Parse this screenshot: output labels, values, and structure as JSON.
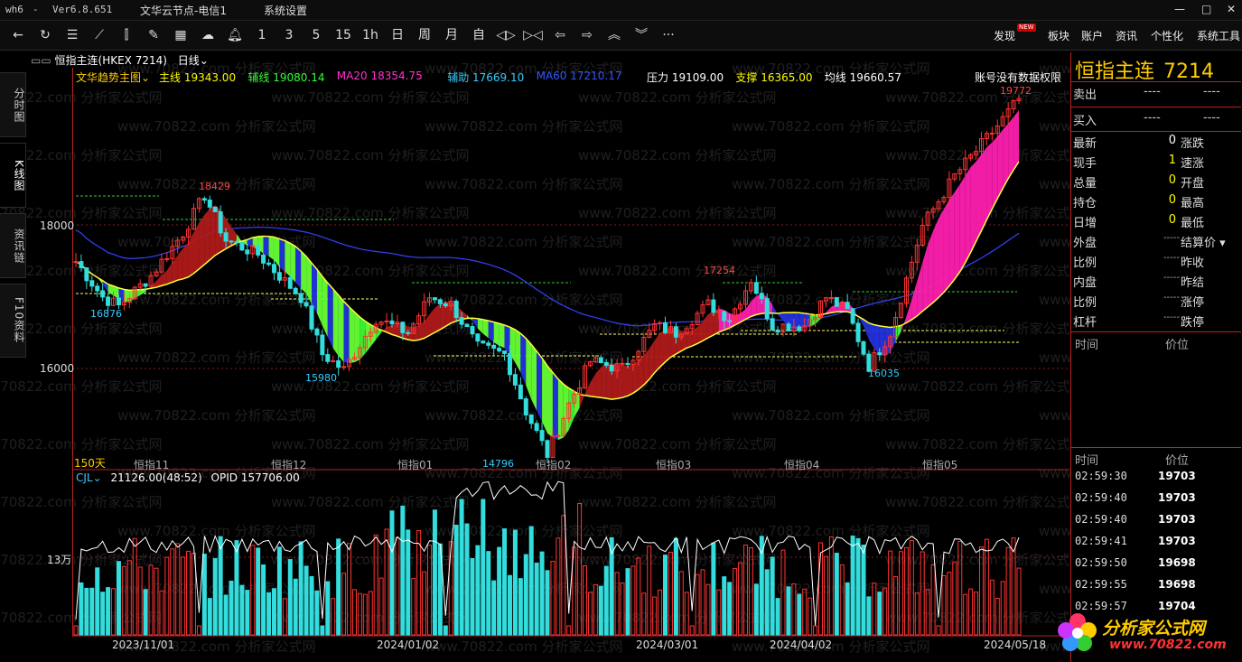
{
  "titlebar": {
    "app": "wh6",
    "dash": "-",
    "version": "Ver6.8.651",
    "server": "文华云节点-电信1",
    "menu": "系统设置",
    "win_min": "—",
    "win_max": "□",
    "win_close": "✕"
  },
  "toolbar": {
    "periods": [
      "1",
      "3",
      "5",
      "15",
      "1h",
      "日",
      "周",
      "月",
      "自"
    ],
    "more": "···",
    "right_items": [
      "发现",
      "板块",
      "账户",
      "资讯",
      "个性化",
      "系统工具"
    ],
    "new_badge": "NEW"
  },
  "side_tabs": [
    "分时图",
    "K线图",
    "资讯链",
    "F10资料"
  ],
  "chart_header": {
    "symbol": "恒指主连(HKEX 7214)",
    "period": "日线"
  },
  "indicators": {
    "name": "文华趋势主图",
    "items": [
      {
        "label": "主线",
        "value": "19343.00",
        "color": "#ffff00"
      },
      {
        "label": "辅线",
        "value": "19080.14",
        "color": "#33ff33"
      },
      {
        "label": "MA20",
        "value": "18354.75",
        "color": "#ff33cc"
      },
      {
        "label": "辅助",
        "value": "17669.10",
        "color": "#33ccff"
      },
      {
        "label": "MA60",
        "value": "17210.17",
        "color": "#3355ff"
      },
      {
        "label": "压力",
        "value": "19109.00",
        "color": "#ffffff"
      },
      {
        "label": "支撑",
        "value": "16365.00",
        "color": "#ffff00"
      },
      {
        "label": "均线",
        "value": "19660.57",
        "color": "#ffffff"
      }
    ]
  },
  "notice": "账号没有数据权限",
  "price_axis": [
    "18000",
    "16000"
  ],
  "price_labels": [
    {
      "text": "18429",
      "color": "#ff4444"
    },
    {
      "text": "16876",
      "color": "#33ccff"
    },
    {
      "text": "15980",
      "color": "#33ccff"
    },
    {
      "text": "14796",
      "color": "#33ccff"
    },
    {
      "text": "17254",
      "color": "#ff4444"
    },
    {
      "text": "16035",
      "color": "#33ccff"
    },
    {
      "text": "19772",
      "color": "#ff4444"
    }
  ],
  "period_count": "150天",
  "contract_labels": [
    "恒指11",
    "恒指12",
    "恒指01",
    "恒指02",
    "恒指03",
    "恒指04",
    "恒指05"
  ],
  "volume_header": {
    "name": "CJL",
    "values": "21126.00(48:52)",
    "opid": "OPID 157706.00"
  },
  "volume_axis": "13万",
  "dates": [
    "2023/11/01",
    "2024/01/02",
    "2024/03/01",
    "2024/04/02",
    "2024/05/18"
  ],
  "quote": {
    "title": "恒指主连",
    "code": "7214",
    "sell_label": "卖出",
    "buy_label": "买入",
    "dashes": "----",
    "rows": [
      {
        "l": "最新",
        "v": "0",
        "vc": "#ffffff",
        "r": "涨跌"
      },
      {
        "l": "现手",
        "v": "1",
        "vc": "#ffff00",
        "r": "速涨"
      },
      {
        "l": "总量",
        "v": "0",
        "vc": "#ffff00",
        "r": "开盘"
      },
      {
        "l": "持仓",
        "v": "0",
        "vc": "#ffff00",
        "r": "最高"
      },
      {
        "l": "日增",
        "v": "0",
        "vc": "#ffff00",
        "r": "最低"
      },
      {
        "l": "外盘",
        "v": "-----",
        "vc": "#aaaaaa",
        "r": "结算价"
      },
      {
        "l": "比例",
        "v": "-----",
        "vc": "#aaaaaa",
        "r": "昨收"
      },
      {
        "l": "内盘",
        "v": "-----",
        "vc": "#aaaaaa",
        "r": "昨结"
      },
      {
        "l": "比例",
        "v": "-----",
        "vc": "#aaaaaa",
        "r": "涨停"
      },
      {
        "l": "杠杆",
        "v": "-----",
        "vc": "#aaaaaa",
        "r": "跌停"
      }
    ],
    "col_time": "时间",
    "col_price": "价位"
  },
  "ticks": [
    {
      "time": "02:59:30",
      "price": "19703"
    },
    {
      "time": "02:59:40",
      "price": "19703"
    },
    {
      "time": "02:59:40",
      "price": "19703"
    },
    {
      "time": "02:59:41",
      "price": "19703"
    },
    {
      "time": "02:59:50",
      "price": "19698"
    },
    {
      "time": "02:59:55",
      "price": "19698"
    },
    {
      "time": "02:59:57",
      "price": "19704"
    }
  ],
  "logo": {
    "name": "分析家公式网",
    "url": "www.70822.com"
  },
  "watermark": "www.70822.com 分析家公式网"
}
